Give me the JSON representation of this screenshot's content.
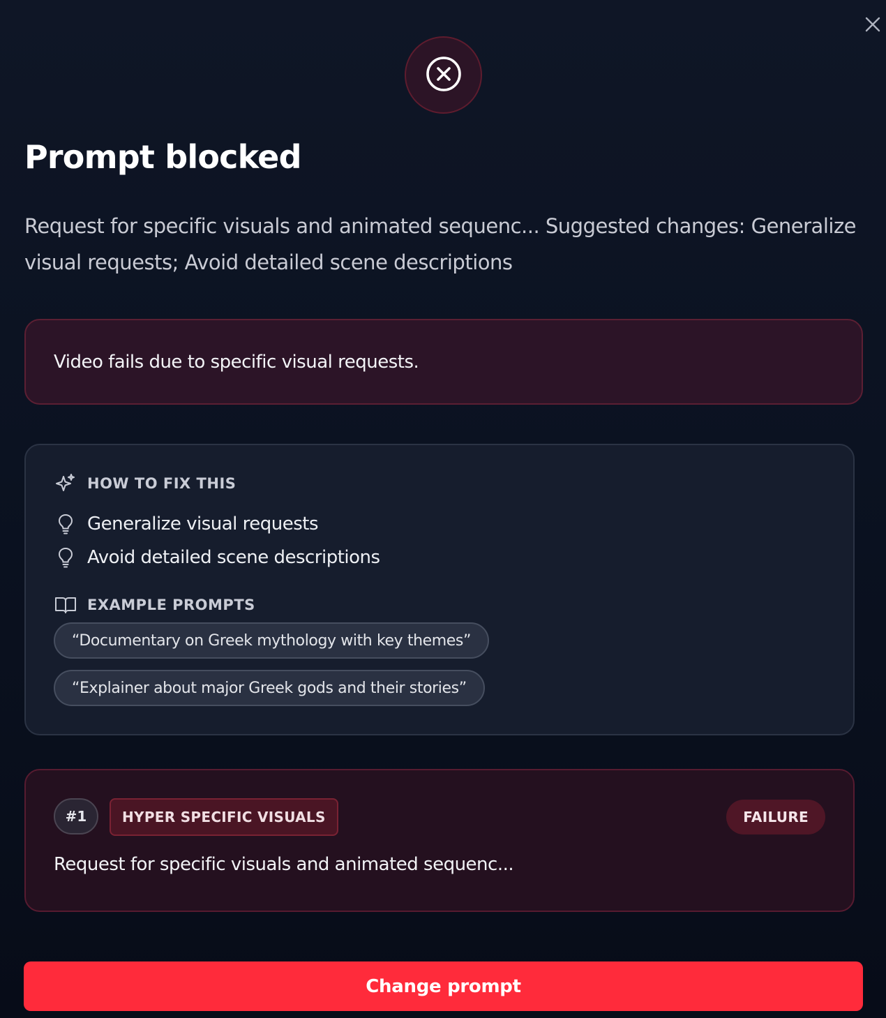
{
  "dialog": {
    "title": "Prompt blocked",
    "subtitle": "Request for specific visuals and animated sequenc... Suggested changes: Generalize visual requests; Avoid detailed scene descriptions",
    "reason": "Video fails due to specific visual requests."
  },
  "icons": {
    "close": "close-icon",
    "status": "x-circle-icon",
    "fix_heading": "sparkles-icon",
    "tip": "lightbulb-icon",
    "examples_heading": "book-open-icon"
  },
  "fix": {
    "heading": "HOW TO FIX THIS",
    "tips": [
      "Generalize visual requests",
      "Avoid detailed scene descriptions"
    ],
    "examples_heading": "EXAMPLE PROMPTS",
    "examples": [
      "“Documentary on Greek mythology with key themes”",
      "“Explainer about major Greek gods and their stories”"
    ]
  },
  "issue": {
    "number": "#1",
    "category": "HYPER SPECIFIC VISUALS",
    "status": "FAILURE",
    "text": "Request for specific visuals and animated sequenc..."
  },
  "actions": {
    "change_prompt": "Change prompt"
  },
  "colors": {
    "background": "#0b1221",
    "accent_red": "#ff2b3b",
    "error_panel": "#2c1427",
    "error_border": "#5c1f33",
    "card": "#161d2d"
  }
}
